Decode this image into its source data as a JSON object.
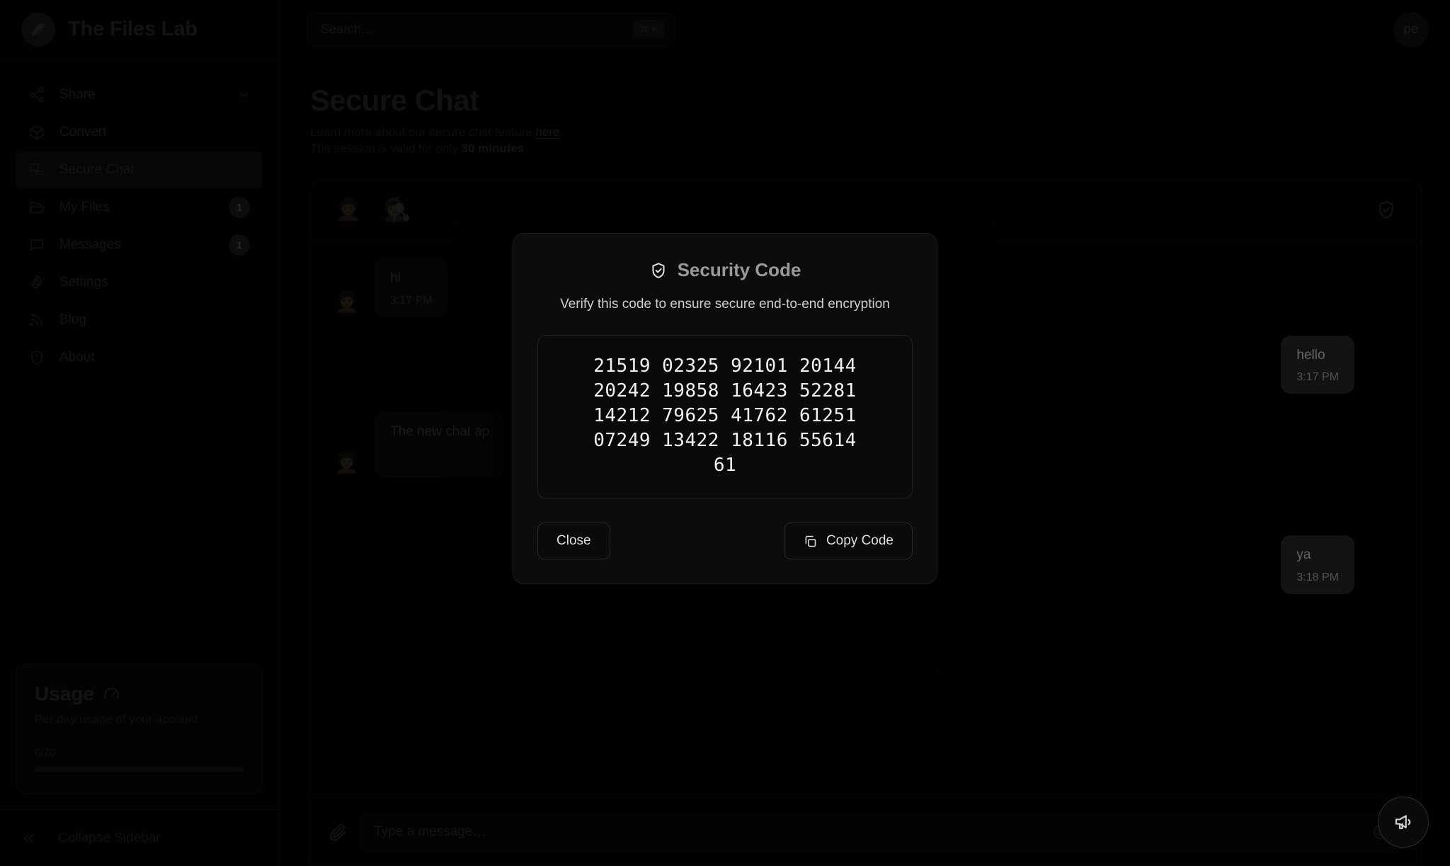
{
  "brand": {
    "name": "The Files Lab",
    "logo_icon": "feather-logo-icon"
  },
  "search": {
    "placeholder": "Search…",
    "value": "",
    "shortcut": "⌘ K",
    "icon": "search-icon"
  },
  "account": {
    "avatar_initials": "pe"
  },
  "sidebar": {
    "items": [
      {
        "label": "Share",
        "icon": "share-icon",
        "badge": "",
        "chevron": true,
        "active": false
      },
      {
        "label": "Convert",
        "icon": "box-icon",
        "badge": "",
        "chevron": false,
        "active": false
      },
      {
        "label": "Secure Chat",
        "icon": "chat-bubbles-icon",
        "badge": "",
        "chevron": false,
        "active": true
      },
      {
        "label": "My Files",
        "icon": "folder-icon",
        "badge": "1",
        "chevron": false,
        "active": false
      },
      {
        "label": "Messages",
        "icon": "message-icon",
        "badge": "1",
        "chevron": false,
        "active": false
      },
      {
        "label": "Settings",
        "icon": "gear-icon",
        "badge": "",
        "chevron": false,
        "active": false
      },
      {
        "label": "Blog",
        "icon": "rss-icon",
        "badge": "",
        "chevron": false,
        "active": false
      },
      {
        "label": "About",
        "icon": "info-shield-icon",
        "badge": "",
        "chevron": false,
        "active": false
      }
    ],
    "usage": {
      "title": "Usage",
      "icon": "gauge-icon",
      "subtitle": "Per day usage of your account",
      "count": "0/20",
      "progress_percent": 0
    },
    "collapse": {
      "label": "Collapse Sidebar",
      "icon": "double-chevron-left-icon"
    }
  },
  "page": {
    "title": "Secure Chat",
    "desc_prefix": "Learn more about our secure chat feature ",
    "desc_link": "here",
    "desc_suffix": ".",
    "session_prefix": "The session is valid for only ",
    "session_value": "30 minutes",
    "session_suffix": "."
  },
  "chat": {
    "header": {
      "peer_avatar_emoji": "🧑‍🦱",
      "incognito_icon": "🕵️",
      "shield_icon": "shield-check-icon"
    },
    "messages": [
      {
        "dir": "in",
        "avatar": "🧑‍🦱",
        "text": "hi",
        "time": "3:17 PM"
      },
      {
        "dir": "out",
        "avatar": "",
        "text": "hello",
        "time": "3:17 PM"
      },
      {
        "dir": "in",
        "avatar": "🧑‍🦱",
        "text": "The new chat ap",
        "time": ""
      },
      {
        "dir": "out",
        "avatar": "",
        "text": "ya",
        "time": "3:18 PM"
      }
    ],
    "composer": {
      "attach_icon": "paperclip-icon",
      "placeholder": "Type a message…",
      "value": "",
      "emoji_icon": "smiley-icon"
    },
    "fab": {
      "icon": "megaphone-icon"
    }
  },
  "modal": {
    "icon": "shield-check-icon",
    "title": "Security Code",
    "description": "Verify this code to ensure secure end-to-end encryption",
    "code_lines": [
      "21519 02325 92101 20144",
      "20242 19858 16423 52281",
      "14212 79625 41762 61251",
      "07249 13422 18116 55614",
      "61"
    ],
    "close_label": "Close",
    "copy_label": "Copy Code",
    "copy_icon": "copy-icon"
  },
  "colors": {
    "page_bg": "#000000",
    "panel_bg": "#0c0c0c",
    "out_bubble": "#2b2b2b",
    "in_bubble": "#0d0d0d",
    "code_text": "#f2f2f2"
  }
}
